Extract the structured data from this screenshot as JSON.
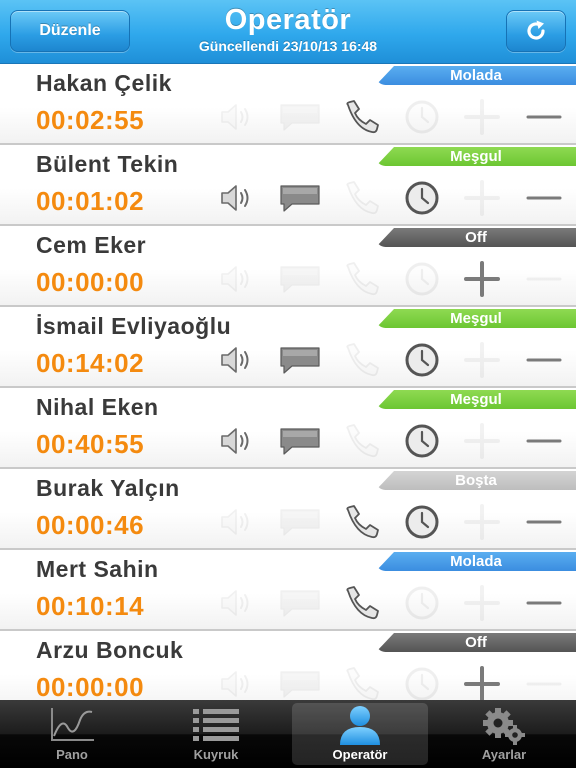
{
  "header": {
    "edit_label": "Düzenle",
    "title": "Operatör",
    "updated": "Güncellendi 23/10/13 16:48",
    "refresh_icon": "refresh-icon"
  },
  "colors": {
    "accent": "#2fa8ec",
    "timer": "#f48a0f",
    "status_molada": "#3b8de0",
    "status_mesgul": "#6cc632",
    "status_off": "#545454",
    "status_bosta": "#bdbdbd"
  },
  "operators": [
    {
      "name": "Hakan Çelik",
      "time": "00:02:55",
      "status": "Molada",
      "status_color": "blue",
      "icons": {
        "speaker": false,
        "chat": false,
        "phone": true,
        "clock": false,
        "plus": false,
        "minus": true
      }
    },
    {
      "name": "Bülent Tekin",
      "time": "00:01:02",
      "status": "Meşgul",
      "status_color": "green",
      "icons": {
        "speaker": true,
        "chat": true,
        "phone": false,
        "clock": true,
        "plus": false,
        "minus": true
      }
    },
    {
      "name": "Cem Eker",
      "time": "00:00:00",
      "status": "Off",
      "status_color": "dark",
      "icons": {
        "speaker": false,
        "chat": false,
        "phone": false,
        "clock": false,
        "plus": true,
        "minus": false
      }
    },
    {
      "name": "İsmail Evliyaoğlu",
      "time": "00:14:02",
      "status": "Meşgul",
      "status_color": "green",
      "icons": {
        "speaker": true,
        "chat": true,
        "phone": false,
        "clock": true,
        "plus": false,
        "minus": true
      }
    },
    {
      "name": "Nihal Eken",
      "time": "00:40:55",
      "status": "Meşgul",
      "status_color": "green",
      "icons": {
        "speaker": true,
        "chat": true,
        "phone": false,
        "clock": true,
        "plus": false,
        "minus": true
      }
    },
    {
      "name": "Burak Yalçın",
      "time": "00:00:46",
      "status": "Boşta",
      "status_color": "light",
      "icons": {
        "speaker": false,
        "chat": false,
        "phone": true,
        "clock": true,
        "plus": false,
        "minus": true
      }
    },
    {
      "name": "Mert Sahin",
      "time": "00:10:14",
      "status": "Molada",
      "status_color": "blue",
      "icons": {
        "speaker": false,
        "chat": false,
        "phone": true,
        "clock": false,
        "plus": false,
        "minus": true
      }
    },
    {
      "name": "Arzu Boncuk",
      "time": "00:00:00",
      "status": "Off",
      "status_color": "dark",
      "icons": {
        "speaker": false,
        "chat": false,
        "phone": false,
        "clock": false,
        "plus": true,
        "minus": false
      }
    }
  ],
  "tabs": [
    {
      "label": "Pano",
      "icon": "chart-icon",
      "active": false
    },
    {
      "label": "Kuyruk",
      "icon": "list-icon",
      "active": false
    },
    {
      "label": "Operatör",
      "icon": "person-icon",
      "active": true
    },
    {
      "label": "Ayarlar",
      "icon": "gear-icon",
      "active": false
    }
  ]
}
